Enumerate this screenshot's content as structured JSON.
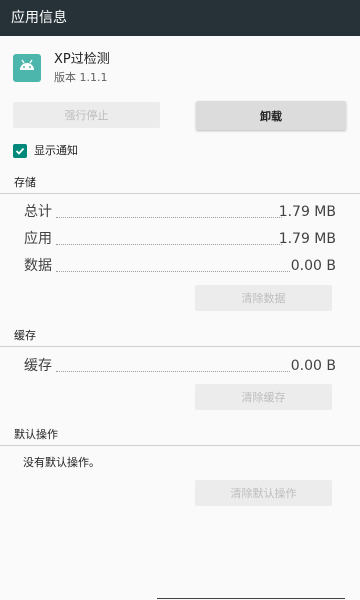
{
  "header": {
    "title": "应用信息"
  },
  "app": {
    "name": "XP过检测",
    "version": "版本 1.1.1",
    "icon": "android-icon",
    "accent": "#4db6ac"
  },
  "actions": {
    "force_stop": "强行停止",
    "uninstall": "卸载"
  },
  "notifications": {
    "label": "显示通知",
    "checked": true
  },
  "storage": {
    "header": "存储",
    "rows": [
      {
        "label": "总计",
        "value": "1.79 MB"
      },
      {
        "label": "应用",
        "value": "1.79 MB"
      },
      {
        "label": "数据",
        "value": "0.00 B"
      }
    ],
    "clear_button": "清除数据"
  },
  "cache": {
    "header": "缓存",
    "rows": [
      {
        "label": "缓存",
        "value": "0.00 B"
      }
    ],
    "clear_button": "清除缓存"
  },
  "defaults": {
    "header": "默认操作",
    "text": "没有默认操作。",
    "clear_button": "清除默认操作"
  },
  "colors": {
    "appbar": "#263238",
    "checkbox": "#00897b"
  }
}
